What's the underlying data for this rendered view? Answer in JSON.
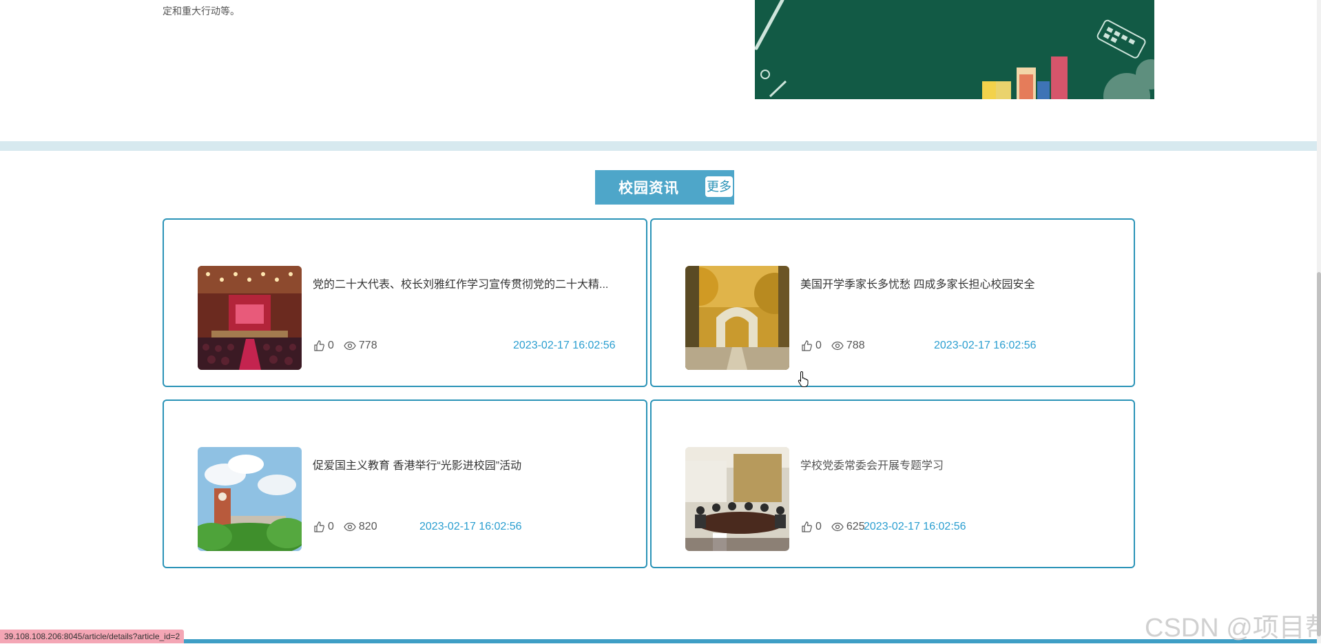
{
  "top_text": "定和重大行动等。",
  "section": {
    "title": "校园资讯",
    "more_label": "更多"
  },
  "articles": [
    {
      "title": "党的二十大代表、校长刘雅红作学习宣传贯彻党的二十大精...",
      "likes": "0",
      "views": "778",
      "date": "2023-02-17 16:02:56",
      "image": "auditorium-photo"
    },
    {
      "title": "美国开学季家长多忧愁 四成多家长担心校园安全",
      "likes": "0",
      "views": "788",
      "date": "2023-02-17 16:02:56",
      "image": "autumn-gate-photo"
    },
    {
      "title": "促爱国主义教育 香港举行“光影进校园”活动",
      "likes": "0",
      "views": "820",
      "date": "2023-02-17 16:02:56",
      "image": "clocktower-photo"
    },
    {
      "title": "学校党委常委会开展专题学习",
      "likes": "0",
      "views": "625",
      "date": "2023-02-17 16:02:56",
      "image": "meeting-room-photo"
    }
  ],
  "status_url": "39.108.108.206:8045/article/details?article_id=2",
  "watermark": "CSDN @项目帮",
  "colors": {
    "accent": "#2a93b7",
    "header_bg": "#4ea6c9",
    "date": "#2a9ed0",
    "banner": "#125a45"
  }
}
